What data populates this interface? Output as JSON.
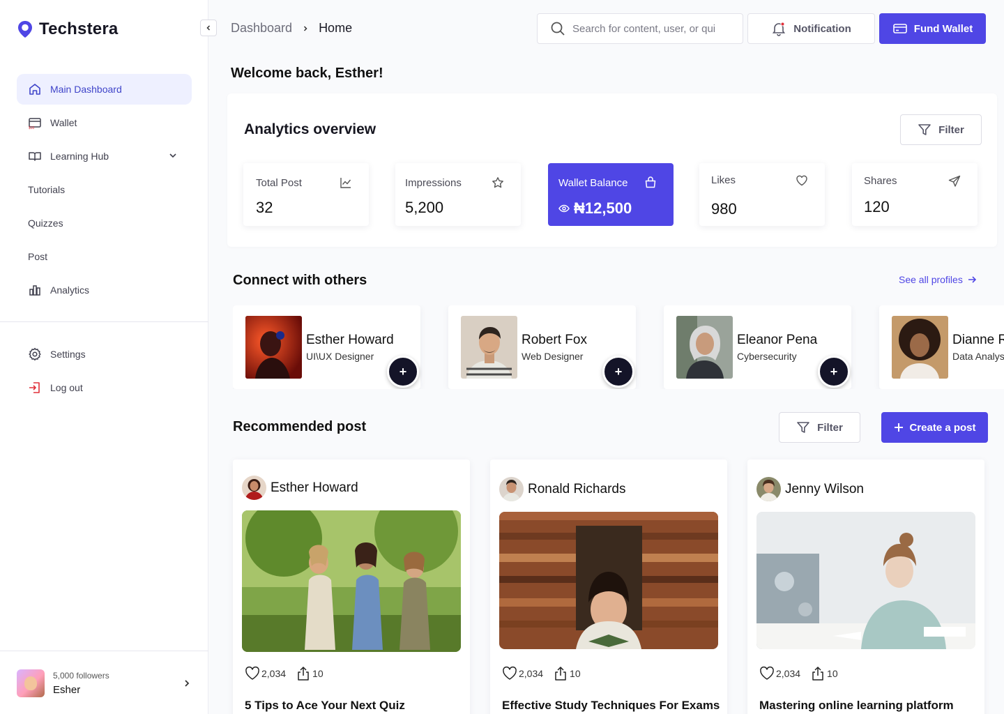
{
  "app": {
    "name": "Techstera"
  },
  "sidebar": {
    "items": [
      {
        "label": "Main Dashboard",
        "icon": "home-icon"
      },
      {
        "label": "Wallet",
        "icon": "wallet-icon"
      },
      {
        "label": "Learning Hub",
        "icon": "book-icon"
      },
      {
        "label": "Tutorials"
      },
      {
        "label": "Quizzes"
      },
      {
        "label": "Post"
      },
      {
        "label": "Analytics",
        "icon": "bar-chart-icon"
      }
    ],
    "bottom": [
      {
        "label": "Settings",
        "icon": "gear-icon"
      },
      {
        "label": "Log out",
        "icon": "logout-icon"
      }
    ],
    "profile": {
      "followers": "5,000 followers",
      "name": "Esher"
    }
  },
  "breadcrumb": {
    "parent": "Dashboard",
    "current": "Home"
  },
  "search": {
    "placeholder": "Search for content, user, or qui"
  },
  "header": {
    "notification_label": "Notification",
    "fund_label": "Fund Wallet"
  },
  "welcome": "Welcome back, Esther!",
  "analytics": {
    "title": "Analytics overview",
    "filter_label": "Filter",
    "stats": [
      {
        "label": "Total Post",
        "value": "32",
        "icon": "trend-chart-icon"
      },
      {
        "label": "Impressions",
        "value": "5,200",
        "icon": "star-icon"
      },
      {
        "label": "Wallet Balance",
        "value": "₦12,500",
        "icon": "bag-icon"
      },
      {
        "label": "Likes",
        "value": "980",
        "icon": "heart-icon"
      },
      {
        "label": "Shares",
        "value": "120",
        "icon": "send-icon"
      }
    ]
  },
  "connect": {
    "title": "Connect with others",
    "see_all": "See all profiles",
    "profiles": [
      {
        "name": "Esther Howard",
        "role": "UI\\UX Designer"
      },
      {
        "name": "Robert Fox",
        "role": "Web Designer"
      },
      {
        "name": "Eleanor Pena",
        "role": "Cybersecurity"
      },
      {
        "name": "Dianne Russell",
        "role": "Data Analyst"
      }
    ],
    "add_label": "+"
  },
  "recommended": {
    "title": "Recommended post",
    "filter_label": "Filter",
    "create_label": "Create a post",
    "posts": [
      {
        "author": "Esther Howard",
        "likes": "2,034",
        "shares": "10",
        "title": "5 Tips to Ace Your Next Quiz"
      },
      {
        "author": "Ronald Richards",
        "likes": "2,034",
        "shares": "10",
        "title": "Effective Study Techniques For Exams"
      },
      {
        "author": "Jenny Wilson",
        "likes": "2,034",
        "shares": "10",
        "title": "Mastering online learning platform"
      }
    ]
  },
  "colors": {
    "accent": "#4f46e5",
    "active_bg": "#eef0ff",
    "dark_button": "#141428",
    "logout": "#e0303a"
  }
}
